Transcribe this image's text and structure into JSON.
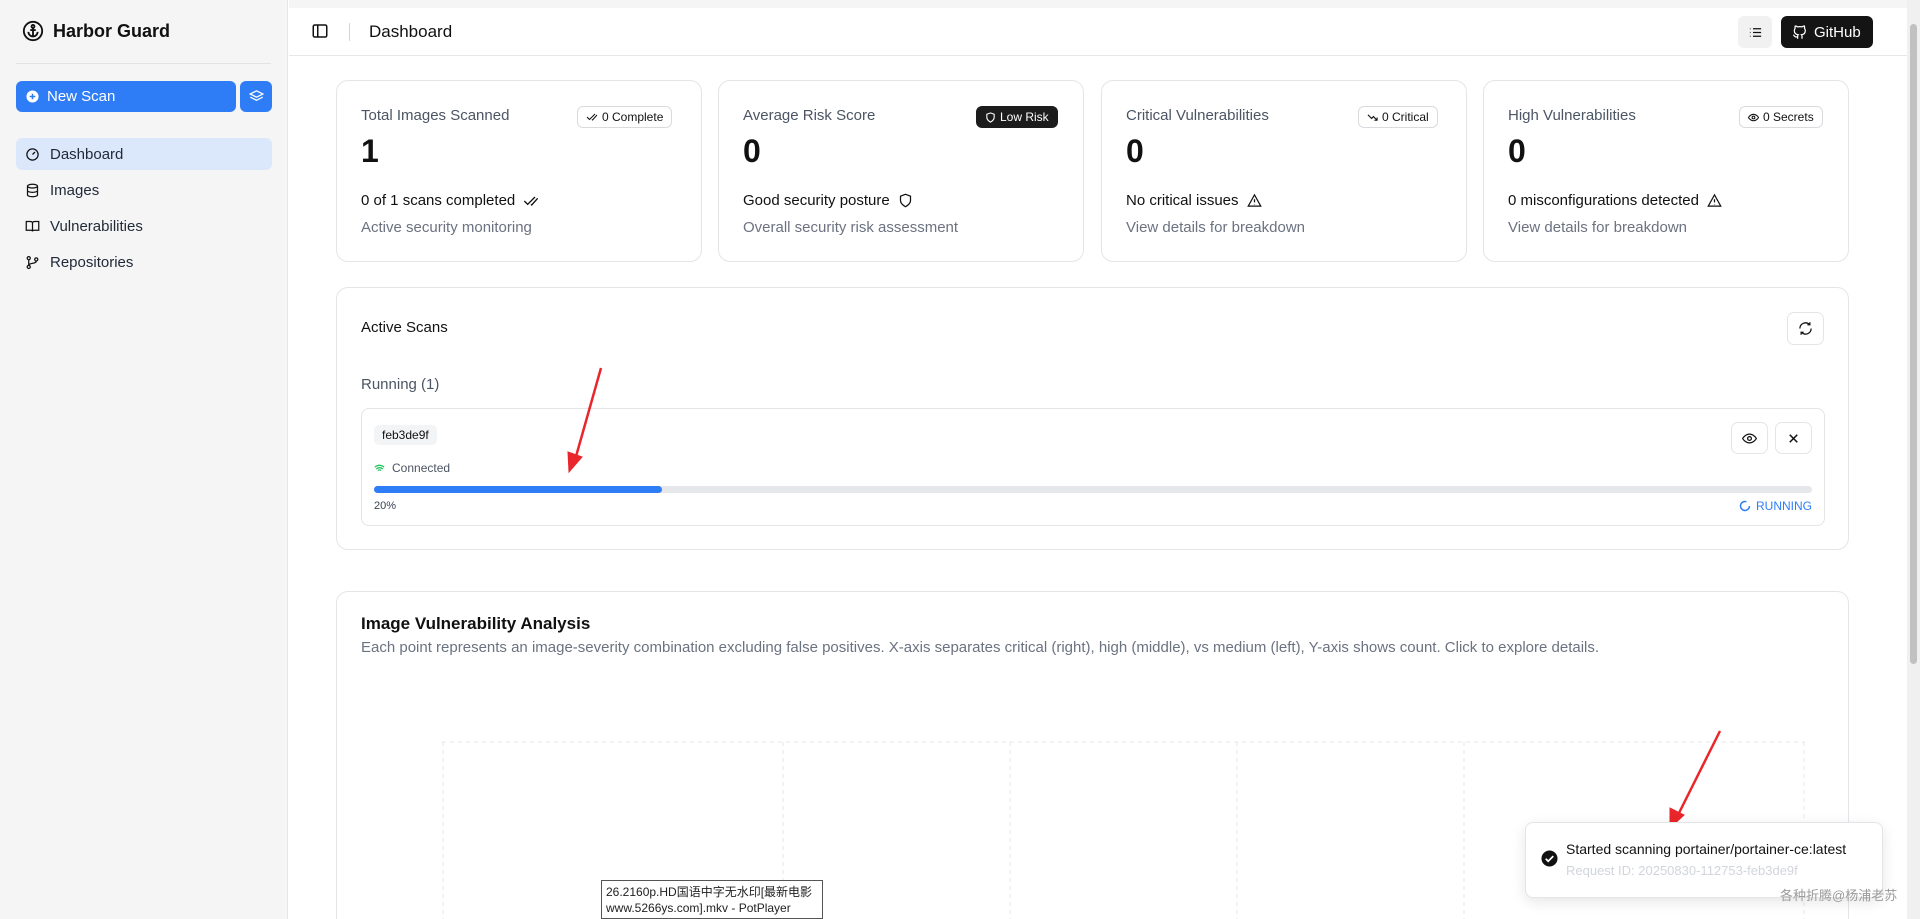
{
  "app": {
    "name": "Harbor Guard"
  },
  "sidebar": {
    "new_scan_label": "New Scan",
    "items": [
      {
        "label": "Dashboard",
        "icon": "gauge-icon",
        "active": true
      },
      {
        "label": "Images",
        "icon": "database-icon",
        "active": false
      },
      {
        "label": "Vulnerabilities",
        "icon": "book-icon",
        "active": false
      },
      {
        "label": "Repositories",
        "icon": "git-branch-icon",
        "active": false
      }
    ]
  },
  "header": {
    "title": "Dashboard",
    "github_label": "GitHub"
  },
  "stats": [
    {
      "label": "Total Images Scanned",
      "value": "1",
      "badge": "0 Complete",
      "line1": "0 of 1 scans completed",
      "line2": "Active security monitoring"
    },
    {
      "label": "Average Risk Score",
      "value": "0",
      "badge": "Low Risk",
      "line1": "Good security posture",
      "line2": "Overall security risk assessment"
    },
    {
      "label": "Critical Vulnerabilities",
      "value": "0",
      "badge": "0 Critical",
      "line1": "No critical issues",
      "line2": "View details for breakdown"
    },
    {
      "label": "High Vulnerabilities",
      "value": "0",
      "badge": "0 Secrets",
      "line1": "0 misconfigurations detected",
      "line2": "View details for breakdown"
    }
  ],
  "active_scans": {
    "title": "Active Scans",
    "running_label": "Running (1)",
    "scan": {
      "id": "feb3de9f",
      "connection": "Connected",
      "progress_label": "20%",
      "progress": 0.2,
      "status": "RUNNING"
    }
  },
  "analysis": {
    "title": "Image Vulnerability Analysis",
    "description": "Each point represents an image-severity combination excluding false positives. X-axis separates critical (right), high (middle), vs medium (left), Y-axis shows count. Click to explore details."
  },
  "toast": {
    "message": "Started scanning portainer/portainer-ce:latest",
    "sub": "Request ID: 20250830-112753-feb3de9f"
  },
  "overlay": {
    "line1": "26.2160p.HD国语中字无水印[最新电影",
    "line2": "www.5266ys.com].mkv - PotPlayer"
  },
  "watermark": "各种折腾@杨浦老苏",
  "colors": {
    "primary": "#2f7df6",
    "annotation": "#e8262b",
    "dark_badge": "#1c1c1c"
  }
}
